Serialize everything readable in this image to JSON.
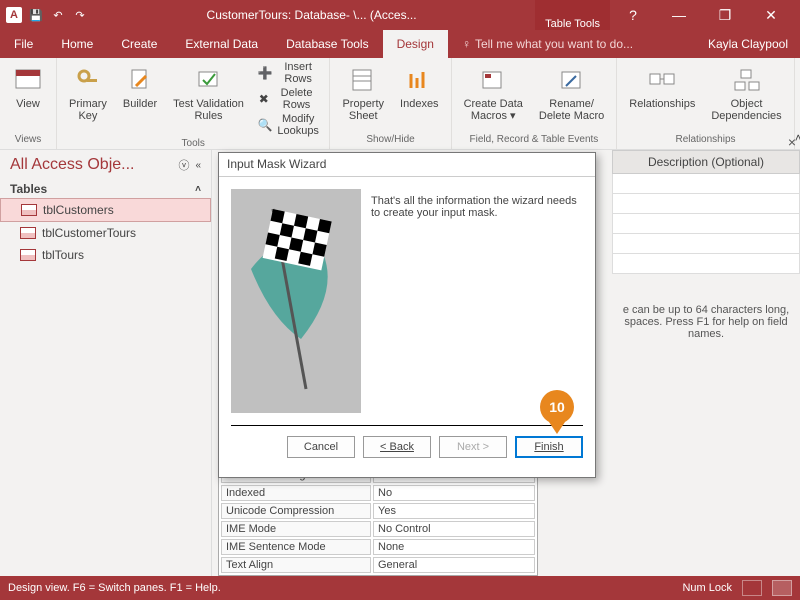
{
  "titlebar": {
    "appicon": "A",
    "title": "CustomerTours: Database- \\... (Acces...",
    "contextTab": "Table Tools",
    "help": "?"
  },
  "menu": {
    "items": [
      "File",
      "Home",
      "Create",
      "External Data",
      "Database Tools",
      "Design"
    ],
    "active": "Design",
    "tellme_prefix": "♀",
    "tellme": "Tell me what you want to do...",
    "user": "Kayla Claypool"
  },
  "ribbon": {
    "views": {
      "label": "Views",
      "view": "View"
    },
    "tools": {
      "label": "Tools",
      "primary": "Primary\nKey",
      "builder": "Builder",
      "test": "Test Validation\nRules",
      "insert": "Insert Rows",
      "delete": "Delete Rows",
      "modify": "Modify Lookups"
    },
    "showhide": {
      "label": "Show/Hide",
      "property": "Property\nSheet",
      "indexes": "Indexes"
    },
    "events": {
      "label": "Field, Record & Table Events",
      "create": "Create Data\nMacros ▾",
      "rename": "Rename/\nDelete Macro"
    },
    "relationships": {
      "label": "Relationships",
      "rel": "Relationships",
      "obj": "Object\nDependencies"
    }
  },
  "nav": {
    "title": "All Access Obje...",
    "section": "Tables",
    "items": [
      "tblCustomers",
      "tblCustomerTours",
      "tblTours"
    ]
  },
  "desc": {
    "header": "Description (Optional)",
    "hint": "e can be up to 64 characters long, spaces. Press F1 for help on field names."
  },
  "props": [
    [
      "Allow Zero Length",
      "No"
    ],
    [
      "Indexed",
      "No"
    ],
    [
      "Unicode Compression",
      "Yes"
    ],
    [
      "IME Mode",
      "No Control"
    ],
    [
      "IME Sentence Mode",
      "None"
    ],
    [
      "Text Align",
      "General"
    ]
  ],
  "wizard": {
    "title": "Input Mask Wizard",
    "text": "That's all the information the wizard needs to create your input mask.",
    "cancel": "Cancel",
    "back": "< Back",
    "next": "Next >",
    "finish": "Finish"
  },
  "callout": {
    "num": "10"
  },
  "status": {
    "left": "Design view.   F6 = Switch panes.   F1 = Help.",
    "numlock": "Num Lock"
  }
}
